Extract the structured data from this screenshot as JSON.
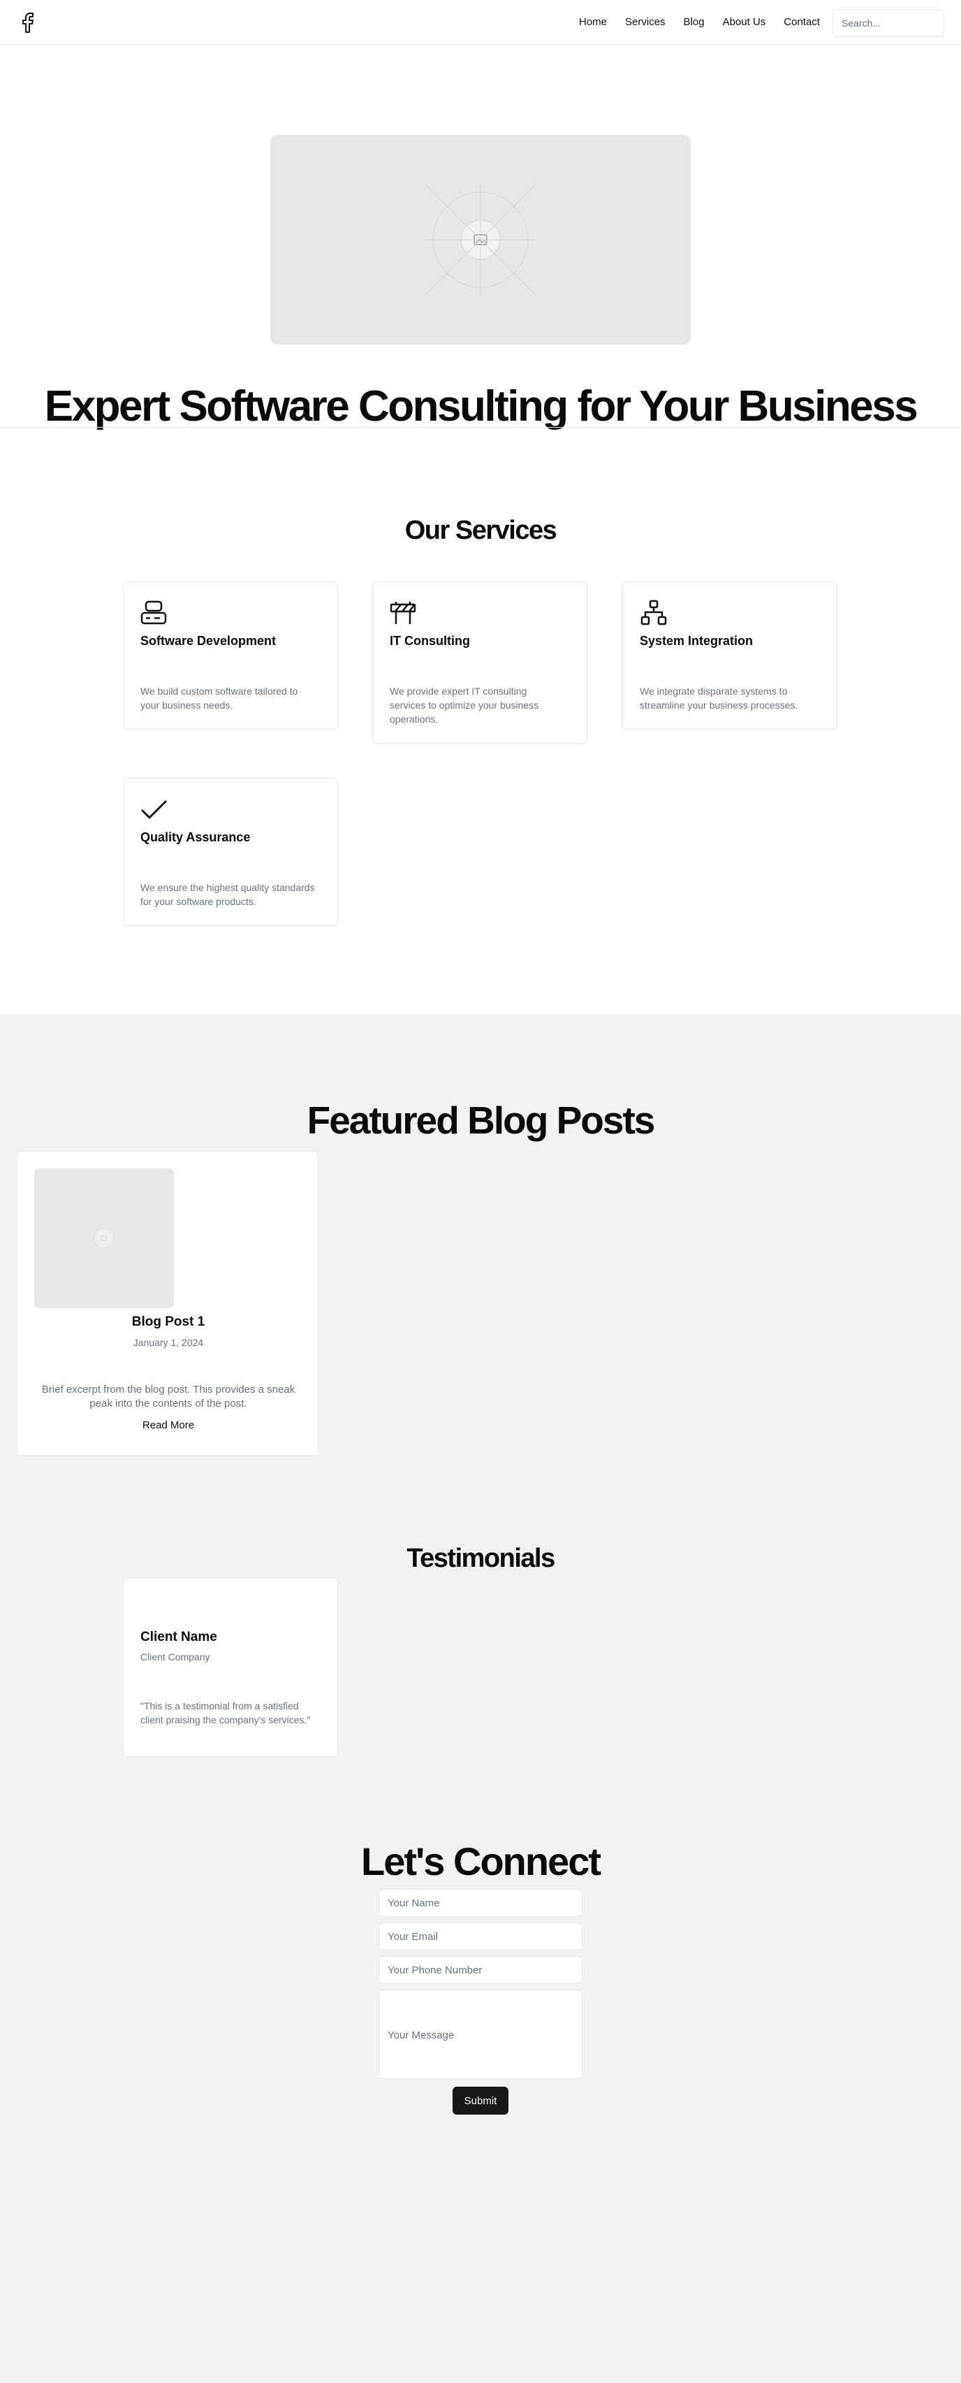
{
  "nav": {
    "logo_icon": "facebook-icon",
    "links": [
      "Home",
      "Services",
      "Blog",
      "About Us",
      "Contact"
    ],
    "search_placeholder": "Search..."
  },
  "hero": {
    "image_icon": "image-placeholder-icon",
    "title": "Expert Software Consulting for Your Business"
  },
  "services": {
    "title": "Our Services",
    "items": [
      {
        "icon": "server-icon",
        "title": "Software Development",
        "description": "We build custom software tailored to your business needs."
      },
      {
        "icon": "barrier-icon",
        "title": "IT Consulting",
        "description": "We provide expert IT consulting services to optimize your business operations."
      },
      {
        "icon": "network-icon",
        "title": "System Integration",
        "description": "We integrate disparate systems to streamline your business processes."
      },
      {
        "icon": "check-icon",
        "title": "Quality Assurance",
        "description": "We ensure the highest quality standards for your software products."
      }
    ]
  },
  "blog": {
    "title": "Featured Blog Posts",
    "posts": [
      {
        "title": "Blog Post 1",
        "date": "January 1, 2024",
        "excerpt": "Brief excerpt from the blog post. This provides a sneak peak into the contents of the post.",
        "read_more": "Read More"
      }
    ]
  },
  "testimonials": {
    "title": "Testimonials",
    "items": [
      {
        "name": "Client Name",
        "company": "Client Company",
        "text": "\"This is a testimonial from a satisfied client praising the company's services.\""
      }
    ]
  },
  "contact": {
    "title": "Let's Connect",
    "name_placeholder": "Your Name",
    "email_placeholder": "Your Email",
    "phone_placeholder": "Your Phone Number",
    "message_placeholder": "Your Message",
    "submit_label": "Submit"
  },
  "colors": {
    "text": "#0a0a0a",
    "muted": "#6b7280",
    "border": "#e5e7eb",
    "grey_bg": "#f1f2f4",
    "button": "#18181b"
  }
}
